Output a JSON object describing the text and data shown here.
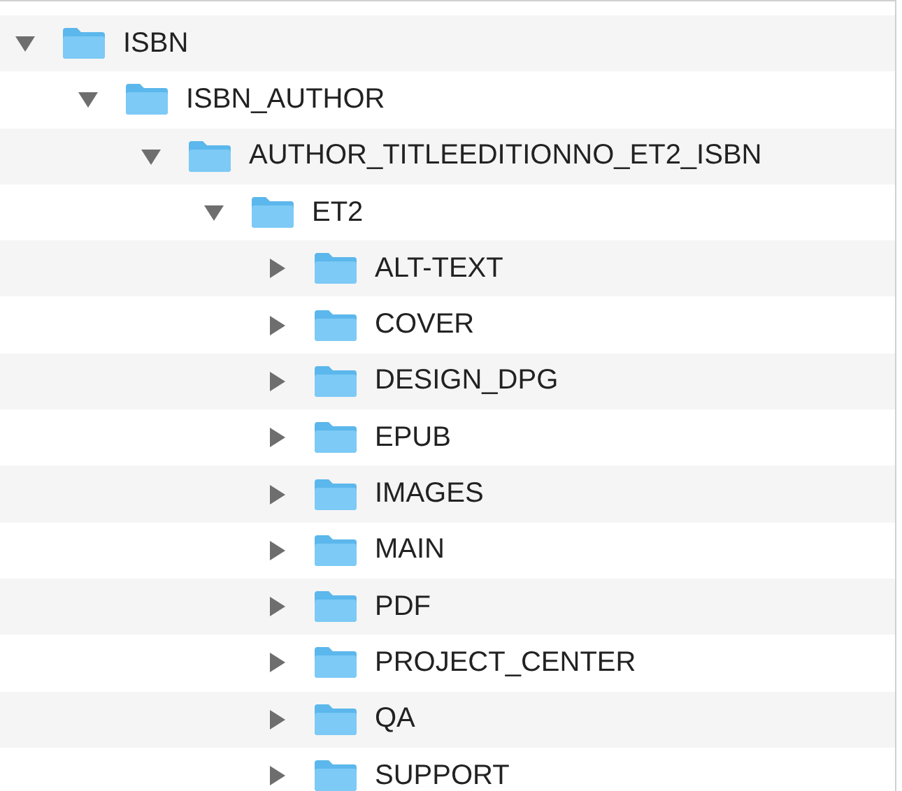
{
  "tree": [
    {
      "name": "ISBN",
      "expanded": true,
      "children": [
        {
          "name": "ISBN_AUTHOR",
          "expanded": true,
          "children": [
            {
              "name": "AUTHOR_TITLEEDITIONNO_ET2_ISBN",
              "expanded": true,
              "children": [
                {
                  "name": "ET2",
                  "expanded": true,
                  "children": [
                    {
                      "name": "ALT-TEXT",
                      "expanded": false
                    },
                    {
                      "name": "COVER",
                      "expanded": false
                    },
                    {
                      "name": "DESIGN_DPG",
                      "expanded": false
                    },
                    {
                      "name": "EPUB",
                      "expanded": false
                    },
                    {
                      "name": "IMAGES",
                      "expanded": false
                    },
                    {
                      "name": "MAIN",
                      "expanded": false
                    },
                    {
                      "name": "PDF",
                      "expanded": false
                    },
                    {
                      "name": "PROJECT_CENTER",
                      "expanded": false
                    },
                    {
                      "name": "QA",
                      "expanded": false
                    },
                    {
                      "name": "SUPPORT",
                      "expanded": false
                    }
                  ]
                }
              ]
            }
          ]
        }
      ]
    }
  ]
}
